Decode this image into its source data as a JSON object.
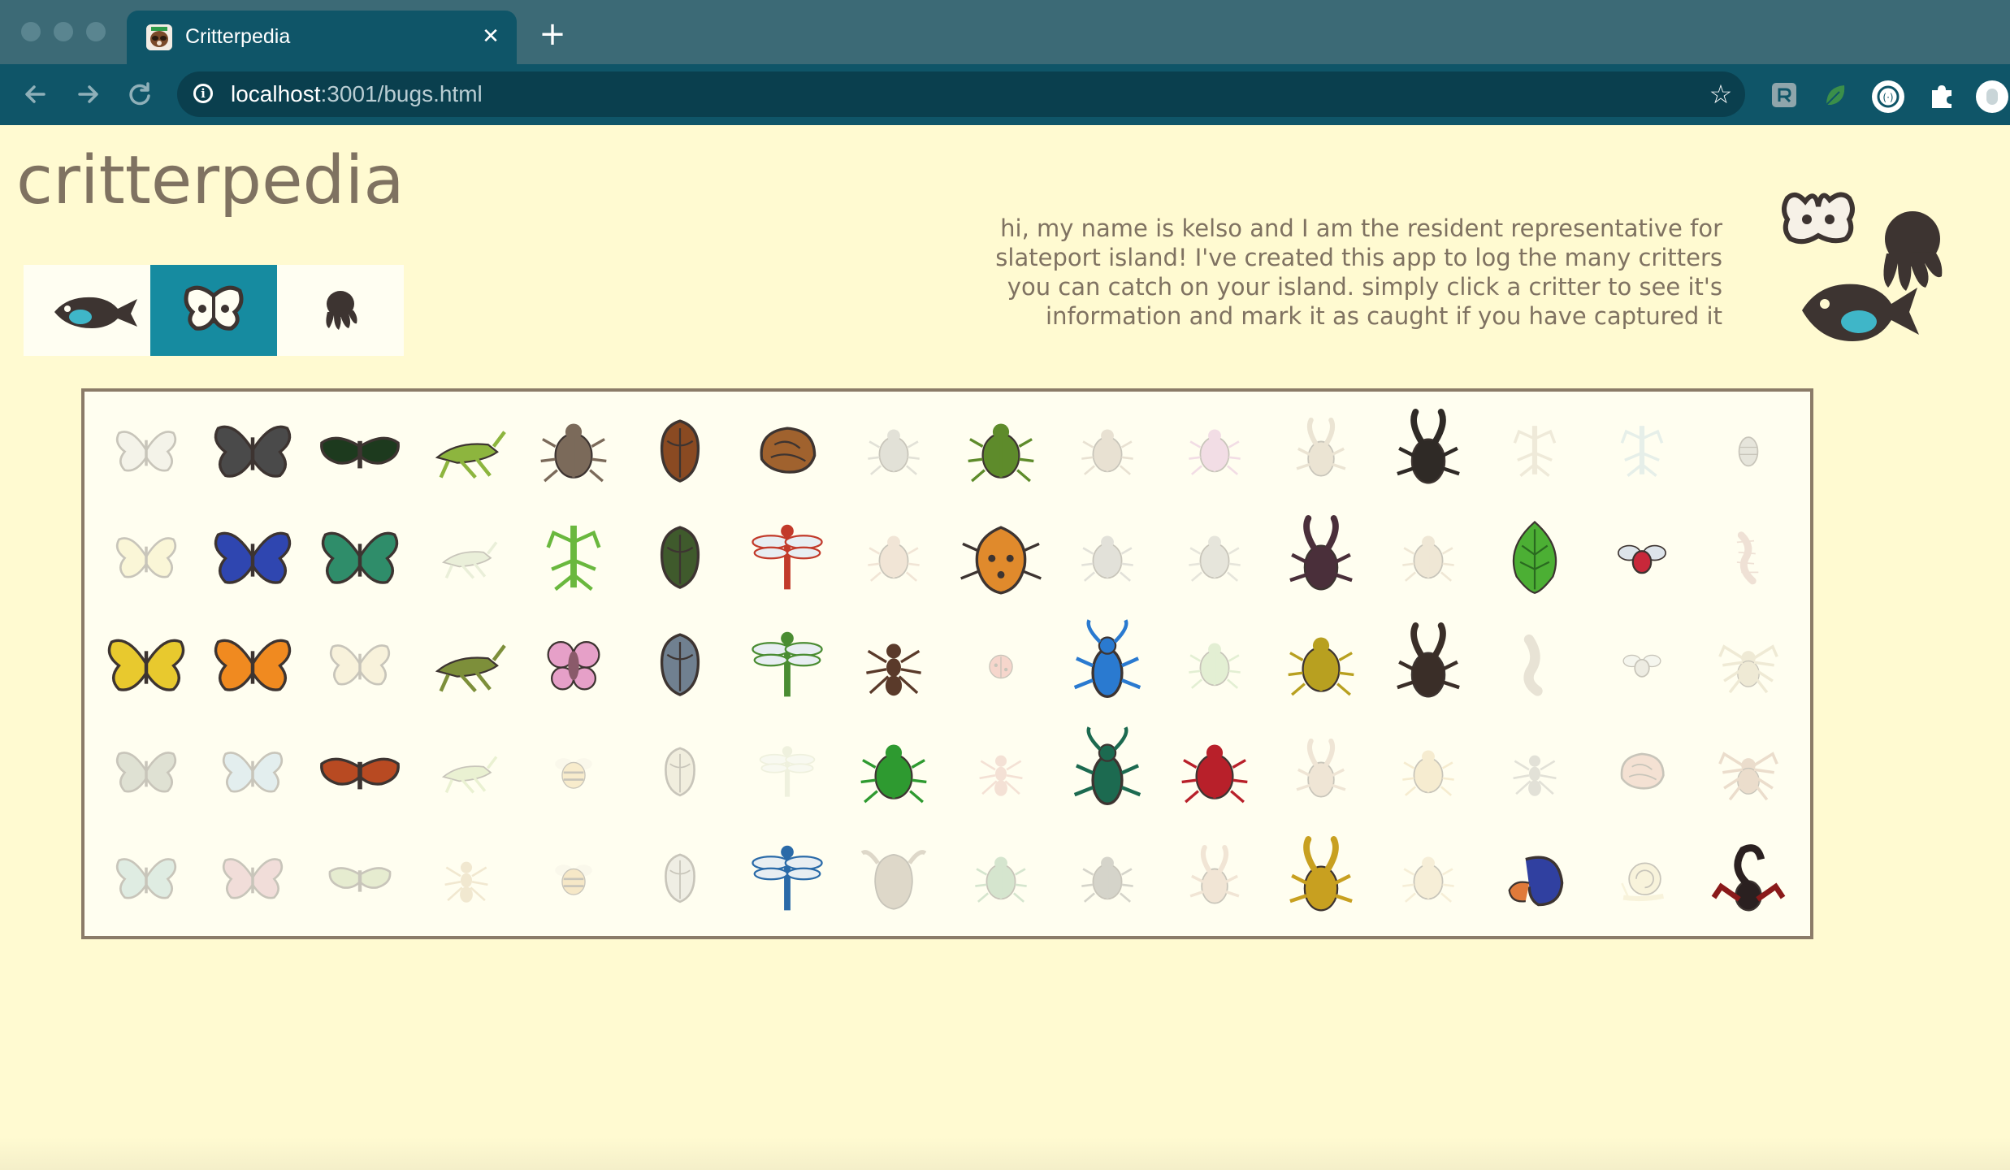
{
  "browser": {
    "tab_title": "Critterpedia",
    "url_host": "localhost",
    "url_rest": ":3001/bugs.html",
    "new_tab_symbol": "+",
    "close_symbol": "✕",
    "star_symbol": "☆",
    "info_symbol": "i"
  },
  "page": {
    "title": "critterpedia",
    "intro": "hi, my name is kelso and I am the resident representative for slateport island! I've created this app to log the many critters you can catch on your island. simply click a critter to see it's information and mark it as caught if you have captured it",
    "tabs": [
      {
        "icon": "fish-icon",
        "active": false
      },
      {
        "icon": "bug-icon",
        "active": true
      },
      {
        "icon": "octopus-icon",
        "active": false
      }
    ],
    "colors": {
      "background": "#fffad1",
      "accent": "#168ba0",
      "text": "#7f7261",
      "grid_border": "#8b7b68",
      "chrome_dark": "#0f5568",
      "chrome_top": "#3c6a76"
    }
  },
  "critters": [
    {
      "kind": "butterfly",
      "color": "#d8d8d8",
      "caught": false
    },
    {
      "kind": "butterfly",
      "color": "#4a4a4a",
      "caught": true
    },
    {
      "kind": "moth",
      "color": "#1d3a1e",
      "caught": true
    },
    {
      "kind": "grasshopper",
      "color": "#8db53e",
      "caught": true
    },
    {
      "kind": "beetle",
      "color": "#7b6a5a",
      "caught": true
    },
    {
      "kind": "cicada",
      "color": "#8a4a22",
      "caught": true
    },
    {
      "kind": "shell",
      "color": "#a0622e",
      "caught": true
    },
    {
      "kind": "beetle",
      "color": "#9a9a9a",
      "caught": false
    },
    {
      "kind": "beetle",
      "color": "#5e8b2b",
      "caught": true
    },
    {
      "kind": "beetle",
      "color": "#b09a88",
      "caught": false
    },
    {
      "kind": "beetle",
      "color": "#d48ac9",
      "caught": false
    },
    {
      "kind": "stag",
      "color": "#b9a48c",
      "caught": false
    },
    {
      "kind": "stag",
      "color": "#2f2a26",
      "caught": true
    },
    {
      "kind": "mantis",
      "color": "#c7b7a0",
      "caught": false
    },
    {
      "kind": "mantis",
      "color": "#a7c9d9",
      "caught": false
    },
    {
      "kind": "pill",
      "color": "#a8a8a8",
      "caught": false
    },
    {
      "kind": "butterfly",
      "color": "#f0e29a",
      "caught": false
    },
    {
      "kind": "butterfly",
      "color": "#2f46b0",
      "caught": true
    },
    {
      "kind": "butterfly",
      "color": "#2f8d6a",
      "caught": true
    },
    {
      "kind": "grasshopper",
      "color": "#b7c9a0",
      "caught": false
    },
    {
      "kind": "mantis",
      "color": "#6ab83e",
      "caught": true
    },
    {
      "kind": "cicada",
      "color": "#3f5a2c",
      "caught": true
    },
    {
      "kind": "dragonfly",
      "color": "#c23a2a",
      "caught": true
    },
    {
      "kind": "beetle",
      "color": "#d0a894",
      "caught": false
    },
    {
      "kind": "stinkbug",
      "color": "#e08a2c",
      "caught": true
    },
    {
      "kind": "beetle",
      "color": "#9a9aa0",
      "caught": false
    },
    {
      "kind": "beetle",
      "color": "#a8a8a8",
      "caught": false
    },
    {
      "kind": "stag",
      "color": "#4a2f3a",
      "caught": true
    },
    {
      "kind": "beetle",
      "color": "#c8ad90",
      "caught": false
    },
    {
      "kind": "leaf",
      "color": "#4caf34",
      "caught": true
    },
    {
      "kind": "fly",
      "color": "#c8283a",
      "caught": true
    },
    {
      "kind": "centipede",
      "color": "#c89a90",
      "caught": false
    },
    {
      "kind": "butterfly",
      "color": "#e8c92e",
      "caught": true
    },
    {
      "kind": "butterfly",
      "color": "#f08a20",
      "caught": true
    },
    {
      "kind": "butterfly",
      "color": "#e7d4a8",
      "caught": false
    },
    {
      "kind": "grasshopper",
      "color": "#7d8f3a",
      "caught": true
    },
    {
      "kind": "orchid",
      "color": "#e6a0c8",
      "caught": true
    },
    {
      "kind": "cicada",
      "color": "#708090",
      "caught": true
    },
    {
      "kind": "dragonfly",
      "color": "#4a8c32",
      "caught": true
    },
    {
      "kind": "ant",
      "color": "#5a3a2a",
      "caught": true
    },
    {
      "kind": "ladybug",
      "color": "#e07070",
      "caught": false
    },
    {
      "kind": "longhorn",
      "color": "#2a7ad0",
      "caught": true
    },
    {
      "kind": "beetle",
      "color": "#9cc98a",
      "caught": false
    },
    {
      "kind": "beetle",
      "color": "#b8a020",
      "caught": true
    },
    {
      "kind": "stag",
      "color": "#3a2e28",
      "caught": true
    },
    {
      "kind": "stick",
      "color": "#b0a090",
      "caught": false
    },
    {
      "kind": "fly",
      "color": "#c0c0c0",
      "caught": false
    },
    {
      "kind": "spider",
      "color": "#c8b890",
      "caught": false
    },
    {
      "kind": "butterfly",
      "color": "#8e9a8a",
      "caught": false
    },
    {
      "kind": "butterfly",
      "color": "#9ec7ea",
      "caught": false
    },
    {
      "kind": "moth",
      "color": "#b84a22",
      "caught": true
    },
    {
      "kind": "grasshopper",
      "color": "#b6d088",
      "caught": false
    },
    {
      "kind": "bee",
      "color": "#e8c070",
      "caught": false
    },
    {
      "kind": "cicada",
      "color": "#d0c8b0",
      "caught": false
    },
    {
      "kind": "dragonfly",
      "color": "#c8d0b0",
      "caught": false
    },
    {
      "kind": "beetle",
      "color": "#2e9a30",
      "caught": true
    },
    {
      "kind": "ant",
      "color": "#d89a90",
      "caught": false
    },
    {
      "kind": "longhorn",
      "color": "#1c6a50",
      "caught": true
    },
    {
      "kind": "beetle",
      "color": "#b8202a",
      "caught": true
    },
    {
      "kind": "stag",
      "color": "#c8a890",
      "caught": false
    },
    {
      "kind": "beetle",
      "color": "#e0c080",
      "caught": false
    },
    {
      "kind": "ant",
      "color": "#9a9a9a",
      "caught": false
    },
    {
      "kind": "shell",
      "color": "#d89a8a",
      "caught": false
    },
    {
      "kind": "spider",
      "color": "#b88a70",
      "caught": false
    },
    {
      "kind": "butterfly",
      "color": "#8ec0c0",
      "caught": false
    },
    {
      "kind": "butterfly",
      "color": "#d08aa0",
      "caught": false
    },
    {
      "kind": "moth",
      "color": "#a8c080",
      "caught": false
    },
    {
      "kind": "ant",
      "color": "#d0b080",
      "caught": false
    },
    {
      "kind": "bee",
      "color": "#e0b060",
      "caught": false
    },
    {
      "kind": "cicada",
      "color": "#c8c8c8",
      "caught": false
    },
    {
      "kind": "dragonfly",
      "color": "#2a6aa8",
      "caught": true
    },
    {
      "kind": "waterbug",
      "color": "#8a7a68",
      "caught": false
    },
    {
      "kind": "beetle",
      "color": "#6aa878",
      "caught": false
    },
    {
      "kind": "beetle",
      "color": "#6a6a6a",
      "caught": false
    },
    {
      "kind": "stag",
      "color": "#d0a890",
      "caught": false
    },
    {
      "kind": "stag",
      "color": "#c8a020",
      "caught": true
    },
    {
      "kind": "beetle",
      "color": "#e0c898",
      "caught": false
    },
    {
      "kind": "hermit",
      "color": "#3040a0",
      "caught": true
    },
    {
      "kind": "snail",
      "color": "#e8d8a8",
      "caught": false
    },
    {
      "kind": "scorpion",
      "color": "#2a2020",
      "caught": true
    }
  ]
}
